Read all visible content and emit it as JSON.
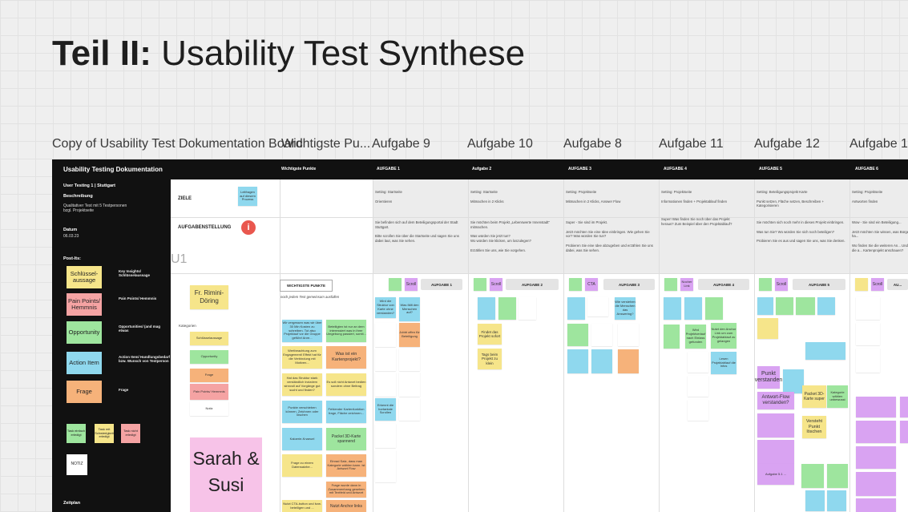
{
  "title": {
    "bold": "Teil II:",
    "rest": " Usability Test Synthese"
  },
  "frame_labels": [
    "Copy of Usability Test Dokumentation Board",
    "Wichtigste Pu...",
    "Aufgabe 9",
    "Aufgabe 10",
    "Aufgabe 8",
    "Aufgabe 11",
    "Aufgabe 12",
    "Aufgabe 1"
  ],
  "panel": {
    "title": "Usability Testing Dokumentation",
    "subtitle": "User Testing 1 | Stuttgart",
    "beschreibung_label": "Beschreibung",
    "beschreibung_text": "Qualitativer Test mit 5 Testpersonen bzgl. Projektseite",
    "datum_label": "Datum",
    "datum_value": "06.03.23",
    "postits_label": "Post-Its:",
    "legend": [
      {
        "label": "Schlüssel-aussage",
        "desc": "Key Insights/ Schlüsselaussage",
        "color": "#f6e58a"
      },
      {
        "label": "Pain Points/ Hemmnis",
        "desc": "Pain Points/ Hemmnis",
        "color": "#f5a3a3"
      },
      {
        "label": "Opportunity",
        "desc": "Opportunities/ (and mag etwas",
        "color": "#9ee59e"
      },
      {
        "label": "Action Item",
        "desc": "Action Item/ Handlungsbedarf bzw. Wunsch von Testperson",
        "color": "#8fd8ee"
      },
      {
        "label": "Frage",
        "desc": "Frage",
        "color": "#f6b27a"
      }
    ],
    "tasks": {
      "green": "Task einfach erledigt",
      "yellow": "Task mit Schwierigkeit erledigt",
      "pink": "Task nicht erledigt"
    },
    "notiz": "NOTIZ",
    "zeitplan": "Zeitplan"
  },
  "header": {
    "wichtig": "Wichtigste Punkte",
    "aufgaben": [
      "AUFGABE 1",
      "Aufgabe 2",
      "AUFGABE 3",
      "AUFGABE 4",
      "AUFGABE 5",
      "AUFGABE 6"
    ]
  },
  "rows": {
    "ziele": "ZIELE",
    "aufgabenstellung": "AUFGABENSTELLUNG",
    "u1": "U1",
    "ziele_note": "Leitfragen auf diesem Prozess",
    "info": "i"
  },
  "ziele_cells": [
    "Setting: Startseite\n\nOrientieren",
    "Setting: Startseite\n\nMitmachen in 2 Klicks",
    "Setting: Projektseite\n\nMitmachen in 2 Klicks, Answer Flow",
    "Setting: Projektseite\n\nInformationen finden + Projektablauf finden",
    "Setting: Beteiligungsprojekt Karte\n\nPunkt setzen, Fläche setzen, Beschreiben + Kategorisieren",
    "Setting: Projektseite\n\nAntworten finden"
  ],
  "aufgaben_cells": [
    "Sie befinden sich auf dem Beteiligungsportal der Stadt Stuttgart.\n\nBitte scrollen Sie über die Startseite und sagen Sie uns dabei laut, was Sie sehen.",
    "Sie möchten beim Projekt „Lebenswerte Innenstadt“ mitmachen.\n\nWas würden Sie jetzt tun?\nWo würden Sie klicken, um loszulegen?\n\nErzählen Sie uns, wie Sie vorgehen.",
    "Super - Sie sind im Projekt.\n\nJetzt möchten Sie eine Idee einbringen. Wie gehen Sie vor? Was würden Sie tun?\n\nProbieren Sie eine Idee abzugeben und erzählen Sie uns dabei, was Sie sehen.",
    "Super! Was finden Sie noch über das Projekt heraus? Zum Beispiel über den Projektablauf?",
    "Sie möchten sich noch mehr in dieses Projekt einbringen.\n\nWas tun Sie? Wo würden Sie sich noch beteiligen?\n\nProbieren Sie es aus und sagen Sie uns, was Sie denken.",
    "Wow - Sie sind ein Beteiligung...\n\nJetzt möchten Sie wissen, was Bürger*innen geantwortet ha...\n\nWo finden Sie die weiteren An... Und: Wo würden Sie sich die a... Kartenprojekt anschauen?"
  ],
  "u1": {
    "person": "Fr. Rimini-Döring",
    "kategorien_label": "Kategorien",
    "kategorien": [
      "Schlüsselaussage",
      "Opportunity",
      "Frage",
      "Pain Points/ Hemmnis",
      "Notiz"
    ],
    "big_sticky": "Sarah & Susi",
    "wichtig_head": "WICHTIGSTE PUNKTE",
    "wichtig_sub": "noch jedem Test gemeinsam ausfüllen",
    "wichtig_notes": [
      "Wir vergessen was wir über 30 Min Kosten zu schreiben. Tut also Projektauf vor die Gruppe geführt Anre...",
      "Beteiligten ist nur an dem interessiert was in ihrer Umgebung passiert, somit...",
      "Wertbeachtung zum Engagement/ Effekt hat für die Verbindung mit Motiven...",
      "Was ist ein Kartenprojekt?",
      "Hat das Struktur stark verständlich trotzdem sinnvoll auf Vorgänge gut sucht und finden?",
      "Es soll nicht Antwort bedien sondern ohne Beitrag",
      "Punkte verschieben können, Zeichnen oder löschen",
      "Fehlender Kartenfunktion frage, Fläche zeichnen...",
      "Kaloerie-Knaeuel",
      "Packel 3D-Karte spannend",
      "Frage zu einem Datensatzbe...",
      "Einrad Satz, dass man Kategorie wählen kann. ist Antwort Flow",
      "Frage wurde dann in Zusammenhang gesehen mit Textfeld und Antwort",
      "Nutzt Anchor links",
      "Nutzt CTA-button und bzw. beteiligen und ..."
    ],
    "task_labels": [
      "Scroll",
      "Scroll",
      "CTA",
      "Nocher Link",
      "Scroll",
      "Scroll"
    ],
    "task_heads": [
      "AUFGABE 1",
      "AUFGABE 2",
      "AUFGABE 3",
      "AUFGABE 4",
      "AUFGABE 5",
      "AU..."
    ],
    "a1_notes": [
      "Wird die Struktur von Karte ohne verstanden?",
      "Was fällt den Menschen auf?",
      "Jobbt offen für Beteiligung",
      "Erkennt die hortantale Scrollen"
    ],
    "a2_notes": [
      "Findet das Projekt sofort",
      "Tags beim Projekt zu klein"
    ],
    "a3_notes": [
      "Wie verstehen die Menschen das Answering?"
    ],
    "a4_notes": [
      "Wird Projektverlauf nach Einlass gefunden",
      "Nutzt den Anchor Link um zum Projektablauf zu gelangen",
      "Lesen Projektablauf die Infos"
    ],
    "a5_notes": [
      "Punkt verstanden",
      "Punkt verstanden?",
      "Antwort-Flow verstanden?",
      "Packet 3D-Karte super",
      "Kategorie wählen unbewusst",
      "Versteht Punkt löschen",
      "Aufgabe 5.1 ..."
    ]
  }
}
